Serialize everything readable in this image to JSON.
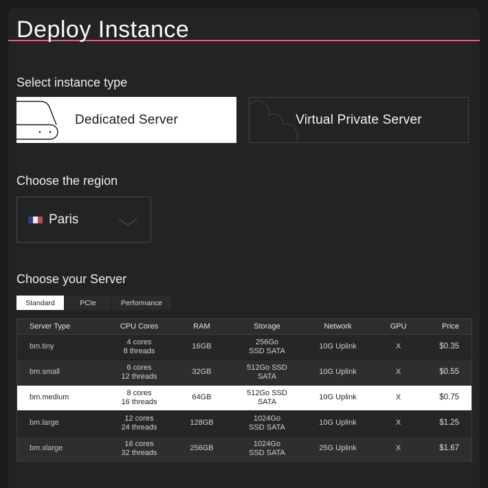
{
  "page": {
    "title": "Deploy Instance",
    "accent_color": "#ee5774"
  },
  "instance_type": {
    "heading": "Select instance type",
    "options": [
      {
        "label": "Dedicated Server",
        "icon": "server-icon",
        "selected": true
      },
      {
        "label": "Virtual Private Server",
        "icon": "cloud-icon",
        "selected": false
      }
    ]
  },
  "region": {
    "heading": "Choose the region",
    "selected": {
      "label": "Paris",
      "flag": "france-flag-icon"
    }
  },
  "server": {
    "heading": "Choose your Server",
    "tabs": [
      {
        "label": "Standard",
        "selected": true
      },
      {
        "label": "PCIe",
        "selected": false
      },
      {
        "label": "Performance",
        "selected": false
      }
    ],
    "table": {
      "columns": [
        "Server Type",
        "CPU Cores",
        "RAM",
        "Storage",
        "Network",
        "GPU",
        "Price"
      ],
      "rows": [
        {
          "type": "bm.tiny",
          "cpu": [
            "4 cores",
            "8 threads"
          ],
          "ram": "16GB",
          "storage": [
            "256Go",
            "SSD SATA"
          ],
          "network": "10G Uplink",
          "gpu": "X",
          "price": "$0.35",
          "selected": false,
          "shade": "dark"
        },
        {
          "type": "bm.small",
          "cpu": [
            "6 cores",
            "12 threads"
          ],
          "ram": "32GB",
          "storage": [
            "512Go SSD",
            "SATA"
          ],
          "network": "10G Uplink",
          "gpu": "X",
          "price": "$0.55",
          "selected": false,
          "shade": "light"
        },
        {
          "type": "bm.medium",
          "cpu": [
            "8 cores",
            "16 threads"
          ],
          "ram": "64GB",
          "storage": [
            "512Go SSD",
            "SATA"
          ],
          "network": "10G Uplink",
          "gpu": "X",
          "price": "$0.75",
          "selected": true,
          "shade": "selected"
        },
        {
          "type": "bm.large",
          "cpu": [
            "12 cores",
            "24 threads"
          ],
          "ram": "128GB",
          "storage": [
            "1024Go",
            "SSD SATA"
          ],
          "network": "10G Uplink",
          "gpu": "X",
          "price": "$1.25",
          "selected": false,
          "shade": "dark"
        },
        {
          "type": "bm.xlarge",
          "cpu": [
            "16 cores",
            "32 threads"
          ],
          "ram": "256GB",
          "storage": [
            "1024Go",
            "SSD SATA"
          ],
          "network": "25G Uplink",
          "gpu": "X",
          "price": "$1.67",
          "selected": false,
          "shade": "light"
        }
      ]
    }
  }
}
